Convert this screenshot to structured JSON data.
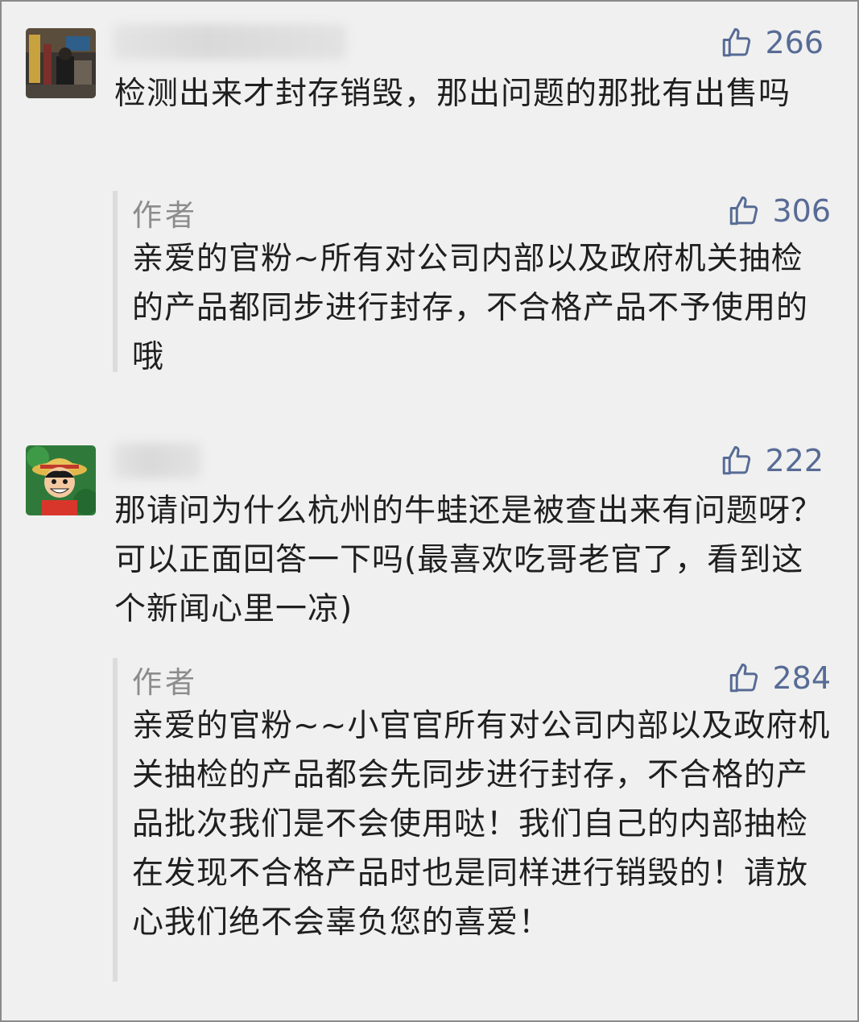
{
  "comments": [
    {
      "username": "",
      "likes": "266",
      "text": "检测出来才封存销毁，那出问题的那批有出售吗",
      "reply": {
        "author": "作者",
        "likes": "306",
        "text": "亲爱的官粉~所有对公司内部以及政府机关抽检的产品都同步进行封存，不合格产品不予使用的哦"
      }
    },
    {
      "username": "",
      "likes": "222",
      "text": "那请问为什么杭州的牛蛙还是被查出来有问题呀？可以正面回答一下吗(最喜欢吃哥老官了，看到这个新闻心里一凉)",
      "reply": {
        "author": "作者",
        "likes": "284",
        "text": "亲爱的官粉~~小官官所有对公司内部以及政府机关抽检的产品都会先同步进行封存，不合格的产品批次我们是不会使用哒！我们自己的内部抽检在发现不合格产品时也是同样进行销毁的！请放心我们绝不会辜负您的喜爱！"
      }
    }
  ],
  "icons": {
    "like": "thumbs-up-icon"
  },
  "colors": {
    "like": "#576b95",
    "text": "#1f1f1f",
    "author": "#8c8c8c",
    "background": "#f0f0f0"
  }
}
